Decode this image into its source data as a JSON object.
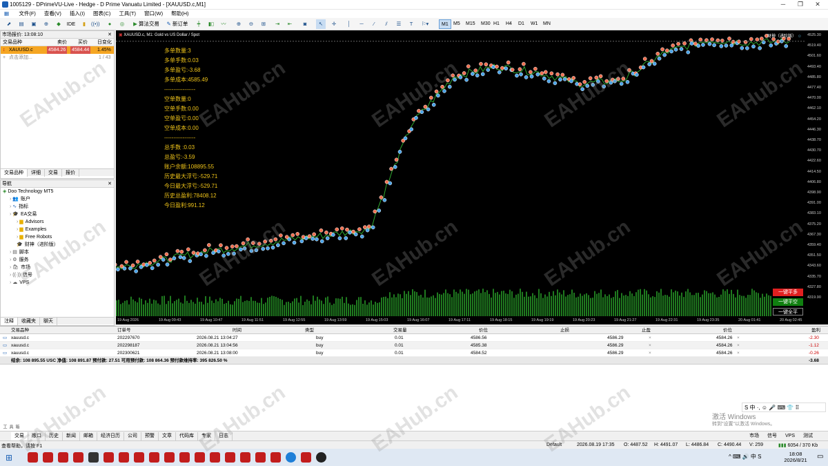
{
  "window": {
    "title": "1005129 - DPrimeVU-Live - Hedge - D Prime Vanuatu Limited - [XAUUSD.c,M1]"
  },
  "menu": [
    "文件(F)",
    "查看(V)",
    "插入(I)",
    "图表(C)",
    "工具(T)",
    "窗口(W)",
    "帮助(H)"
  ],
  "toolbar": {
    "ide": "IDE",
    "algo": "算法交易",
    "new_order": "新订单",
    "timeframes": [
      "M1",
      "M5",
      "M15",
      "M30",
      "H1",
      "H4",
      "D1",
      "W1",
      "MN"
    ],
    "active_tf": "M1"
  },
  "market_watch": {
    "title": "市场报价: 13:08:10",
    "cols": [
      "交易品种",
      "卖价",
      "买价",
      "日变化"
    ],
    "rows": [
      {
        "symbol": "XAUUSD.c",
        "bid": "4584.26",
        "ask": "4584.44",
        "change": "1.45%"
      }
    ],
    "add": "点击添加...",
    "count": "1 / 43",
    "tabs": [
      "交易品种",
      "详细",
      "交易",
      "报价"
    ]
  },
  "navigator": {
    "title": "导航",
    "root": "Doo Technology MT5",
    "items": [
      {
        "label": "账户",
        "icon": "accounts-icon"
      },
      {
        "label": "指标",
        "icon": "indicator-icon"
      },
      {
        "label": "EA交易",
        "icon": "ea-icon"
      },
      {
        "label": "Advisors",
        "icon": "folder-icon"
      },
      {
        "label": "Examples",
        "icon": "folder-icon"
      },
      {
        "label": "Free Robots",
        "icon": "folder-icon"
      },
      {
        "label": "财神（进阶版）",
        "icon": "robot-icon"
      },
      {
        "label": "脚本",
        "icon": "script-icon"
      },
      {
        "label": "服务",
        "icon": "service-icon"
      },
      {
        "label": "市场",
        "icon": "market-icon"
      },
      {
        "label": "信号",
        "icon": "signal-icon"
      },
      {
        "label": "VPS",
        "icon": "vps-icon"
      }
    ],
    "tabs": [
      "注释",
      "收藏夹",
      "聊天"
    ]
  },
  "chart": {
    "header": "XAUUSD.c, M1:  Gold vs US Dollar / Spot",
    "ea_label": "财神（进阶版）",
    "info": [
      "多单数量:3",
      "多单手数:0.03",
      "多单盈亏:-3.68",
      "多单成本:4585.49",
      "-----------------",
      "空单数量:0",
      "空单手数:0.00",
      "空单盈亏:0.00",
      "空单成本:0.00",
      "-----------------",
      "总手数 :0.03",
      "总盈亏:-3.59",
      "账户余额:108895.55",
      "历史最大浮亏:-529.71",
      "今日最大浮亏:-529.71",
      "历史总盈利:78408.12",
      "今日盈利:991.12"
    ],
    "buttons": [
      "一键平多",
      "一键平空",
      "一键全平"
    ],
    "chart_data": {
      "type": "line",
      "x": [
        "19 Aug 2026",
        "19 Aug 09:43",
        "19 Aug 10:47",
        "19 Aug 11:51",
        "19 Aug 12:55",
        "19 Aug 13:59",
        "19 Aug 15:03",
        "19 Aug 16:07",
        "19 Aug 17:11",
        "19 Aug 18:15",
        "19 Aug 19:19",
        "19 Aug 20:23",
        "19 Aug 21:27",
        "19 Aug 22:31",
        "19 Aug 23:35",
        "20 Aug 01:41",
        "20 Aug 02:45"
      ],
      "y": [
        4340,
        4345,
        4352,
        4357,
        4362,
        4366,
        4371,
        4455,
        4493,
        4501,
        4496,
        4487,
        4490,
        4512,
        4522,
        4520,
        4521
      ],
      "yticks": [
        "4525.30",
        "4519.40",
        "4501.60",
        "4493.40",
        "4485.80",
        "4477.40",
        "4470.00",
        "4462.10",
        "4454.20",
        "4446.30",
        "4438.70",
        "4430.70",
        "4422.60",
        "4414.50",
        "4406.80",
        "4398.90",
        "4391.00",
        "4383.10",
        "4375.20",
        "4367.30",
        "4359.40",
        "4351.50",
        "4343.60",
        "4335.70",
        "4327.80",
        "4319.90"
      ],
      "ylim": [
        4319.9,
        4525.3
      ]
    }
  },
  "trade": {
    "cols": [
      "交易品种",
      "订单号",
      "时间",
      "类型",
      "交易量",
      "价位",
      "止损",
      "止盈",
      "价位",
      "盈利"
    ],
    "rows": [
      {
        "symbol": "xauusd.c",
        "ticket": "202297670",
        "time": "2026.08.21 13:04:27",
        "type": "buy",
        "volume": "0.01",
        "price": "4586.56",
        "sl": "",
        "tp": "4586.29",
        "cur": "4584.26",
        "profit": "-2.30"
      },
      {
        "symbol": "xauusd.c",
        "ticket": "202298187",
        "time": "2026.08.21 13:04:56",
        "type": "buy",
        "volume": "0.01",
        "price": "4585.38",
        "sl": "",
        "tp": "4586.29",
        "cur": "4584.26",
        "profit": "-1.12"
      },
      {
        "symbol": "xauusd.c",
        "ticket": "202300621",
        "time": "2026.08.21 13:08:00",
        "type": "buy",
        "volume": "0.01",
        "price": "4584.52",
        "sl": "",
        "tp": "4586.29",
        "cur": "4584.26",
        "profit": "-0.26"
      }
    ],
    "summary": "结余: 108 895.55 USC  净值: 108 891.87  预付款: 27.51  可用预付款: 108 864.36  预付款维持率: 395 826.50 %",
    "total": "-3.68"
  },
  "bottom_tabs": [
    "交易",
    "敞口",
    "历史",
    "新闻",
    "邮箱",
    "经济日历",
    "公司",
    "预警",
    "文章",
    "代码库",
    "专家",
    "日志"
  ],
  "bottom_right": [
    "市场",
    "信号",
    "VPS",
    "测试"
  ],
  "status": {
    "help": "查看帮助，请按 F1",
    "profile": "Default",
    "time": "2026.08.19 17:35",
    "o": "O: 4487.52",
    "h": "H: 4491.07",
    "l": "L: 4486.84",
    "c": "C: 4490.44",
    "v": "V: 259",
    "net": "6054 / 370 Kb"
  },
  "activation": {
    "line1": "激活 Windows",
    "line2": "转到\"设置\"以激活 Windows。"
  },
  "clock": {
    "time": "18:08",
    "date": "2026/8/21"
  },
  "watermark": "EAHub.cn"
}
